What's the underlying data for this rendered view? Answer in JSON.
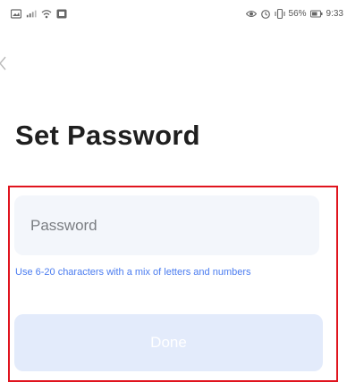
{
  "status_bar": {
    "battery": "56%",
    "time": "9:33",
    "icons": [
      "gallery-icon",
      "signal-icon",
      "wifi-icon",
      "notification-icon",
      "eye-icon",
      "alarm-icon",
      "vibrate-icon",
      "battery-icon"
    ]
  },
  "page": {
    "title": "Set Password"
  },
  "form": {
    "password_placeholder": "Password",
    "password_value": "",
    "hint": "Use 6-20 characters with a mix of letters and numbers",
    "done_label": "Done"
  },
  "colors": {
    "accent": "#4a7cf0",
    "input_bg": "#f3f6fb",
    "button_disabled_bg": "#e3ebfb",
    "highlight_border": "#e0141e"
  }
}
